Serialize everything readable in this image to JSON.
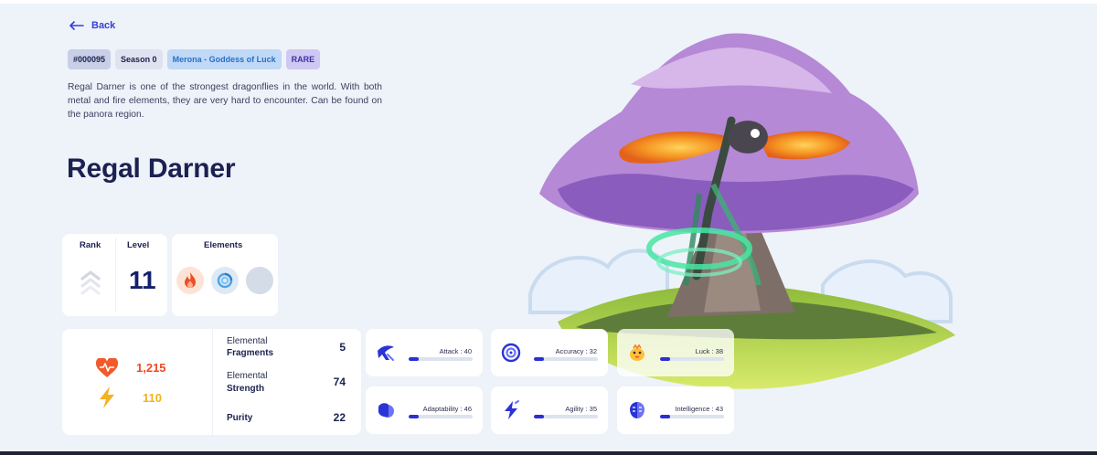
{
  "nav": {
    "back_label": "Back"
  },
  "tags": {
    "id": "#000095",
    "season": "Season 0",
    "goddess": "Merona - Goddess of Luck",
    "rarity": "RARE"
  },
  "description": "Regal Darner is one of the strongest dragonflies in the world. With both metal and fire elements, they are very hard to encounter. Can be found on the panora region.",
  "name": "Regal Darner",
  "rank": {
    "label": "Rank"
  },
  "level": {
    "label": "Level",
    "value": "11"
  },
  "elements": {
    "label": "Elements",
    "icons": [
      "fire-icon",
      "water-icon",
      "empty-slot"
    ]
  },
  "vitals": {
    "health": "1,215",
    "energy": "110"
  },
  "stats": {
    "fragments": {
      "line1": "Elemental",
      "line2": "Fragments",
      "value": "5"
    },
    "strength": {
      "line1": "Elemental",
      "line2": "Strength",
      "value": "74"
    },
    "purity": {
      "label": "Purity",
      "value": "22"
    }
  },
  "attributes": [
    {
      "label": "Attack : 40",
      "icon": "attack-icon",
      "value": 40
    },
    {
      "label": "Accuracy : 32",
      "icon": "accuracy-icon",
      "value": 32
    },
    {
      "label": "Luck : 38",
      "icon": "luck-icon",
      "value": 38
    },
    {
      "label": "Adaptability : 46",
      "icon": "adaptability-icon",
      "value": 46
    },
    {
      "label": "Agility : 35",
      "icon": "agility-icon",
      "value": 35
    },
    {
      "label": "Intelligence : 43",
      "icon": "intelligence-icon",
      "value": 43
    }
  ],
  "colors": {
    "accent": "#3640d8",
    "title": "#1b2150",
    "health": "#ee4a23",
    "energy": "#f2b21c",
    "bar_fill": "#2a2fd6"
  }
}
